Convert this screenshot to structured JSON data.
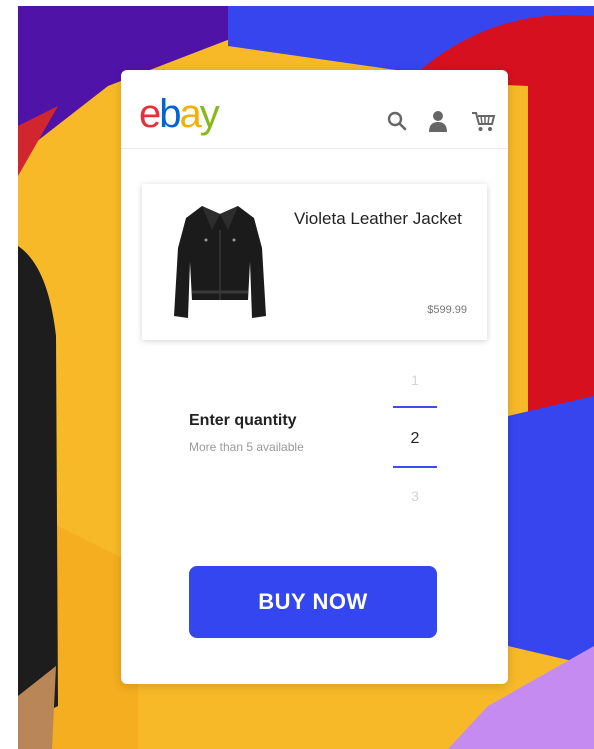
{
  "header": {
    "logo_parts": [
      "e",
      "b",
      "a",
      "y"
    ],
    "icons": [
      "search-icon",
      "user-icon",
      "cart-icon"
    ]
  },
  "product": {
    "title": "Violeta Leather Jacket",
    "price": "$599.99",
    "image": "leather-jacket-image"
  },
  "quantity": {
    "label": "Enter quantity",
    "availability": "More than 5 available",
    "options": [
      "1",
      "2",
      "3"
    ],
    "selected": "2"
  },
  "buy_button": {
    "label": "BUY NOW"
  },
  "colors": {
    "accent": "#3346f0",
    "logo_e": "#e53238",
    "logo_b": "#0064d2",
    "logo_a": "#f5af02",
    "logo_y": "#86b817"
  }
}
